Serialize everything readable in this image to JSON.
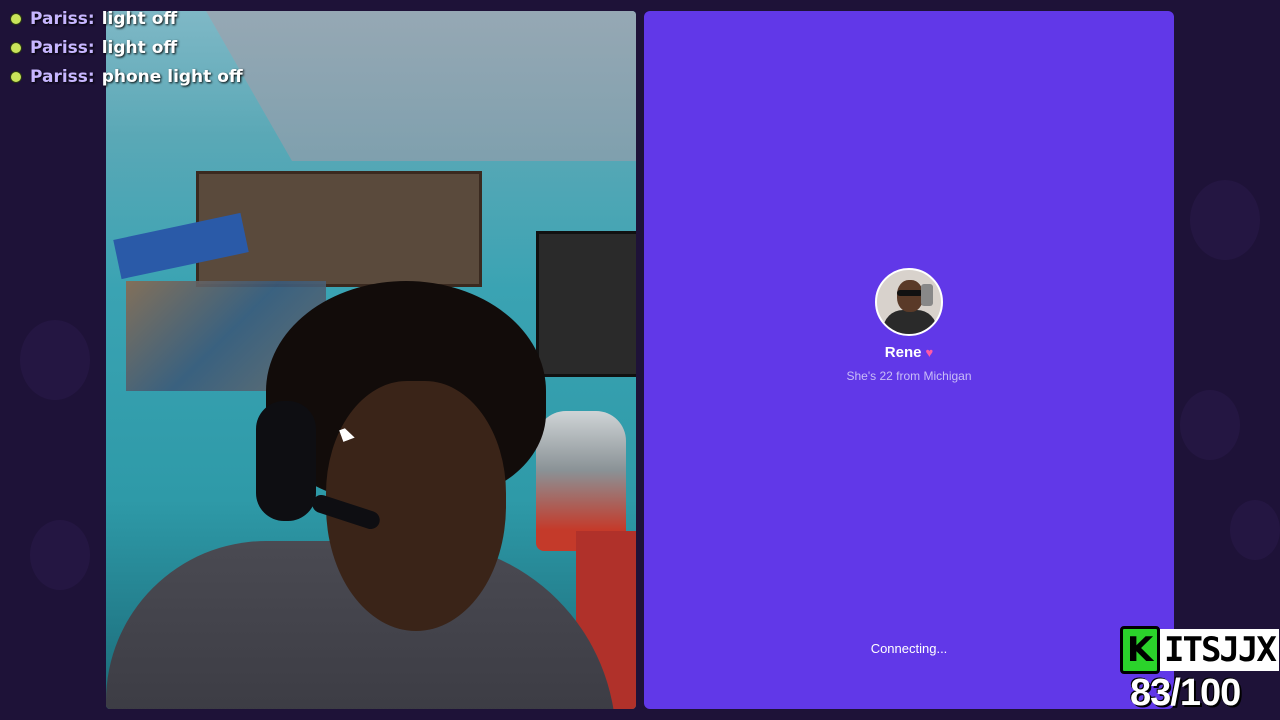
{
  "chat": {
    "messages": [
      {
        "user": "Pariss:",
        "text": "light off"
      },
      {
        "user": "Pariss:",
        "text": "light off"
      },
      {
        "user": "Pariss:",
        "text": "phone light off"
      }
    ]
  },
  "call": {
    "caller_name": "Rene",
    "caller_description": "She's 22 from Michigan",
    "status": "Connecting...",
    "heart_icon": "heart-icon",
    "panel_color": "#6138e8"
  },
  "overlay": {
    "brand_name": "ITSJJX",
    "score": "83/100",
    "brand_color": "#2bd32b"
  }
}
